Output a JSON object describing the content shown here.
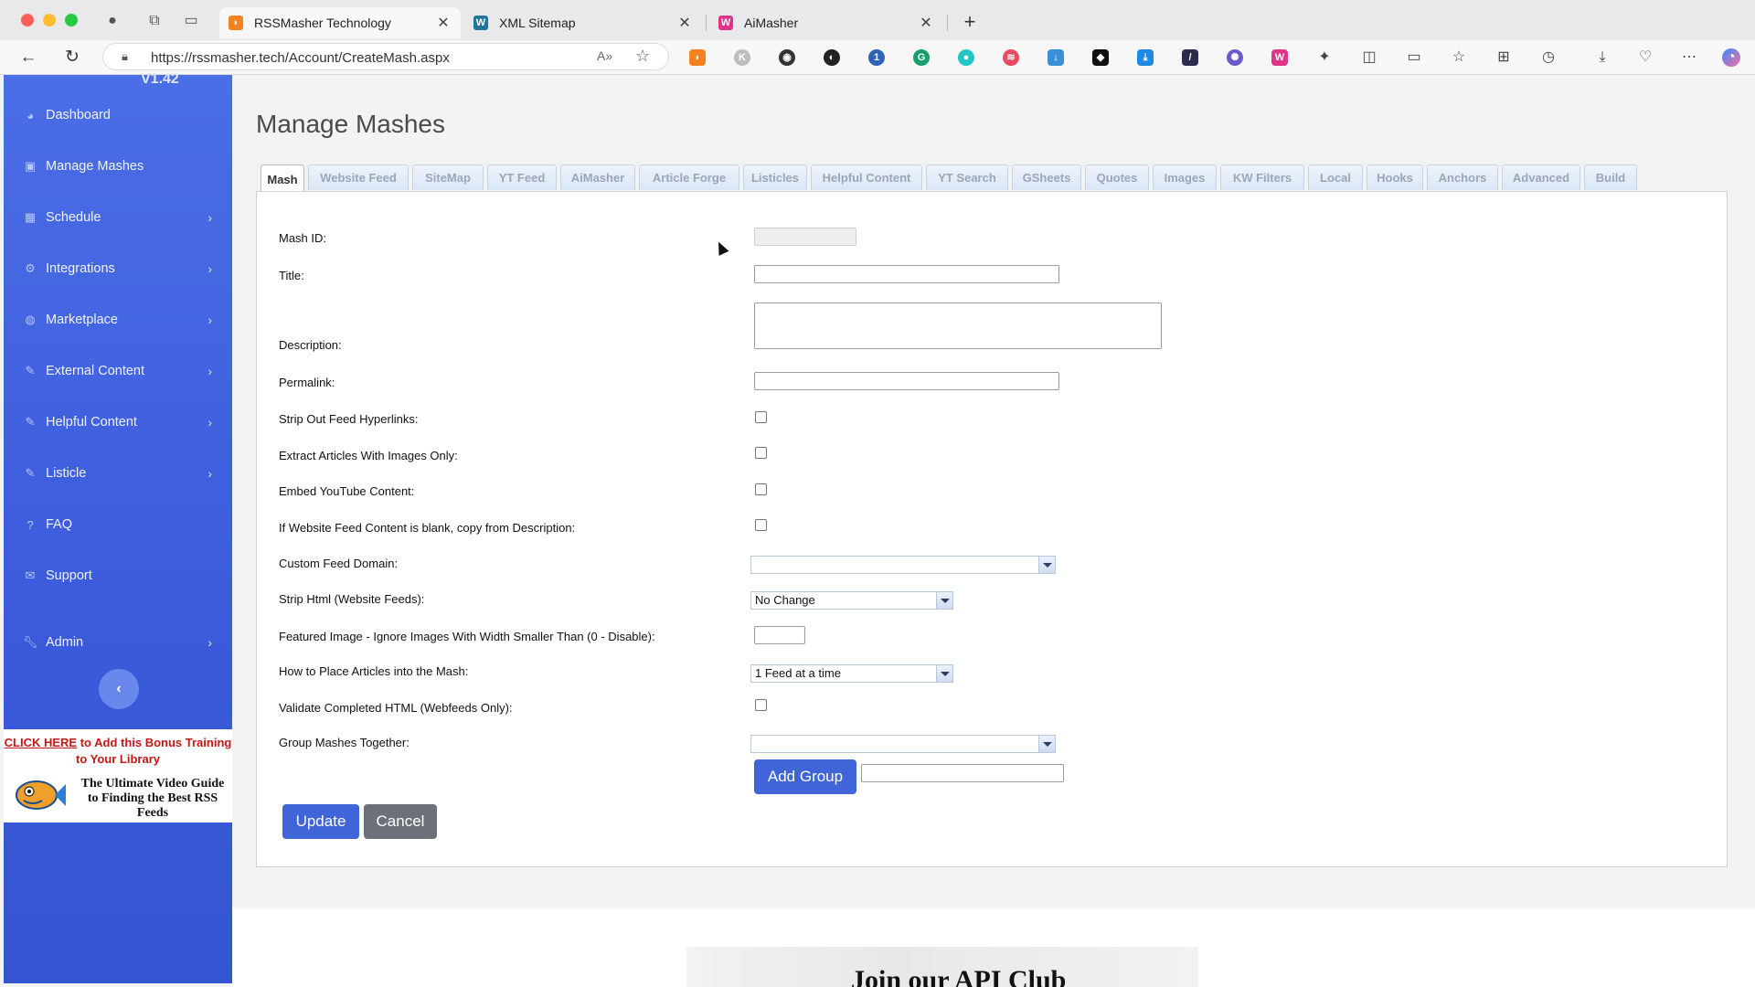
{
  "browser": {
    "tabs": [
      {
        "title": "RSSMasher Technology",
        "active": true
      },
      {
        "title": "XML Sitemap",
        "active": false
      },
      {
        "title": "AiMasher",
        "active": false
      }
    ],
    "url": "https://rssmasher.tech/Account/CreateMash.aspx"
  },
  "sidebar": {
    "version": "V1.42",
    "items": [
      {
        "label": "Dashboard",
        "icon": "dashboard-icon",
        "chevron": false
      },
      {
        "label": "Manage Mashes",
        "icon": "mashes-icon",
        "chevron": false
      },
      {
        "label": "Schedule",
        "icon": "calendar-icon",
        "chevron": true
      },
      {
        "label": "Integrations",
        "icon": "gear-icon",
        "chevron": true
      },
      {
        "label": "Marketplace",
        "icon": "globe-icon",
        "chevron": true
      },
      {
        "label": "External Content",
        "icon": "edit-icon",
        "chevron": true
      },
      {
        "label": "Helpful Content",
        "icon": "edit-icon",
        "chevron": true
      },
      {
        "label": "Listicle",
        "icon": "edit-icon",
        "chevron": true
      },
      {
        "label": "FAQ",
        "icon": "question-icon",
        "chevron": false
      },
      {
        "label": "Support",
        "icon": "envelope-icon",
        "chevron": false
      },
      {
        "label": "Admin",
        "icon": "wrench-icon",
        "chevron": true
      }
    ],
    "promo": {
      "line1_highlight": "CLICK HERE",
      "line1_rest": " to Add this Bonus Training",
      "line2": "to Your Library",
      "title": "The Ultimate Video Guide to Finding the Best RSS Feeds"
    }
  },
  "main": {
    "title": "Manage Mashes",
    "tabs": [
      "Mash",
      "Website Feed",
      "SiteMap",
      "YT Feed",
      "AiMasher",
      "Article Forge",
      "Listicles",
      "Helpful Content",
      "YT Search",
      "GSheets",
      "Quotes",
      "Images",
      "KW Filters",
      "Local",
      "Hooks",
      "Anchors",
      "Advanced",
      "Build"
    ],
    "active_tab": "Mash",
    "form": {
      "mash_id_label": "Mash ID:",
      "title_label": "Title:",
      "description_label": "Description:",
      "permalink_label": "Permalink:",
      "strip_hyperlinks_label": "Strip Out Feed Hyperlinks:",
      "images_only_label": "Extract Articles With Images Only:",
      "embed_youtube_label": "Embed YouTube Content:",
      "copy_description_label": "If Website Feed Content is blank, copy from Description:",
      "custom_domain_label": "Custom Feed Domain:",
      "strip_html_label": "Strip Html (Website Feeds):",
      "strip_html_value": "No Change",
      "featured_image_label": "Featured Image - Ignore Images With Width Smaller Than (0 - Disable):",
      "placement_label": "How to Place Articles into the Mash:",
      "placement_value": "1 Feed at a time",
      "validate_html_label": "Validate Completed HTML (Webfeeds Only):",
      "group_label": "Group Mashes Together:",
      "add_group_label": "Add Group",
      "update_label": "Update",
      "cancel_label": "Cancel"
    },
    "footer_banner": "Join our API Club"
  },
  "colors": {
    "sidebar": "#3b5bdb",
    "primary_button": "#3f65d9",
    "secondary_button": "#6b7079"
  }
}
